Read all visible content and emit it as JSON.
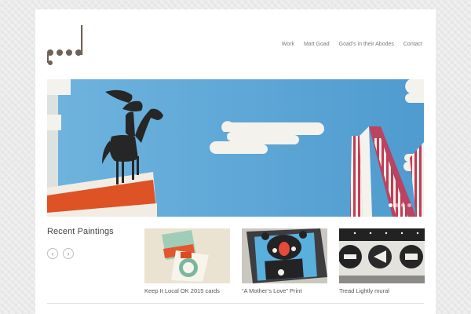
{
  "nav": {
    "items": [
      "Work",
      "Matt Goad",
      "Goad's in their Abodes",
      "Contact"
    ]
  },
  "slider": {
    "slide_count": 4,
    "active_index": 0
  },
  "recent": {
    "title": "Recent Paintings",
    "prev_glyph": "‹",
    "next_glyph": "›",
    "items": [
      {
        "caption": "Keep It Local OK 2015 cards"
      },
      {
        "caption": "“A Mother’s Love” Print"
      },
      {
        "caption": "Tread Lightly mural"
      }
    ]
  },
  "colors": {
    "sky": "#5aa8d8",
    "orange": "#e0542a",
    "dark": "#2b2b2b",
    "cream": "#f3efe6"
  }
}
